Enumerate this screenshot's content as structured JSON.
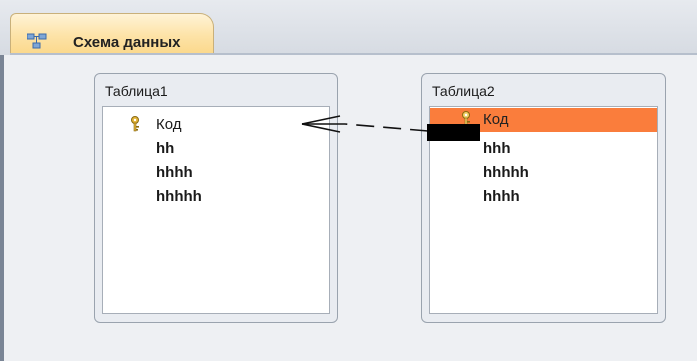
{
  "tab": {
    "label": "Схема данных",
    "icon": "relationships-icon"
  },
  "tables": [
    {
      "title": "Таблица1",
      "fields": [
        {
          "name": "Код",
          "primary_key": true,
          "selected": false
        },
        {
          "name": "hh",
          "primary_key": false,
          "selected": false
        },
        {
          "name": "hhhh",
          "primary_key": false,
          "selected": false
        },
        {
          "name": "hhhhh",
          "primary_key": false,
          "selected": false
        }
      ]
    },
    {
      "title": "Таблица2",
      "fields": [
        {
          "name": "Код",
          "primary_key": true,
          "selected": true
        },
        {
          "name": "hhh",
          "primary_key": false,
          "selected": false
        },
        {
          "name": "hhhhh",
          "primary_key": false,
          "selected": false
        },
        {
          "name": "hhhh",
          "primary_key": false,
          "selected": false
        }
      ]
    }
  ],
  "relationship": {
    "from": "Таблица2.Код",
    "to": "Таблица1.Код",
    "style": "dashed",
    "end_marker": "crow-foot"
  },
  "colors": {
    "selected_row": "#fa7d3c",
    "tab_active": "#fde3a8",
    "canvas": "#eef0f3"
  }
}
